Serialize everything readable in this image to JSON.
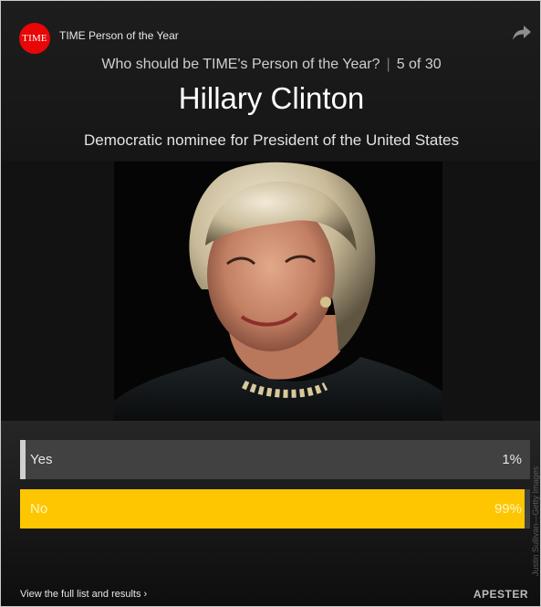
{
  "header": {
    "logo_text": "TIME",
    "brand": "TIME Person of the Year",
    "share_icon": "share-arrow-icon"
  },
  "poll": {
    "question": "Who should be TIME's Person of the Year?",
    "separator": "|",
    "progress": "5 of 30",
    "candidate_name": "Hillary Clinton",
    "candidate_description": "Democratic nominee for President of the United States"
  },
  "options": [
    {
      "label": "Yes",
      "percent_label": "1%",
      "percent": 1,
      "color": "#cfcfcf",
      "text_color": "#e6e6e6"
    },
    {
      "label": "No",
      "percent_label": "99%",
      "percent": 99,
      "color": "#fdc600",
      "text_color": "#fff4c2"
    }
  ],
  "photo_credit": "Justin Sullivan—Getty Images",
  "footer": {
    "view_link": "View the full list and results ›",
    "apester_logo": "APESTER"
  },
  "colors": {
    "brand_red": "#e90606",
    "accent_yellow": "#fdc600",
    "background": "#121212"
  }
}
